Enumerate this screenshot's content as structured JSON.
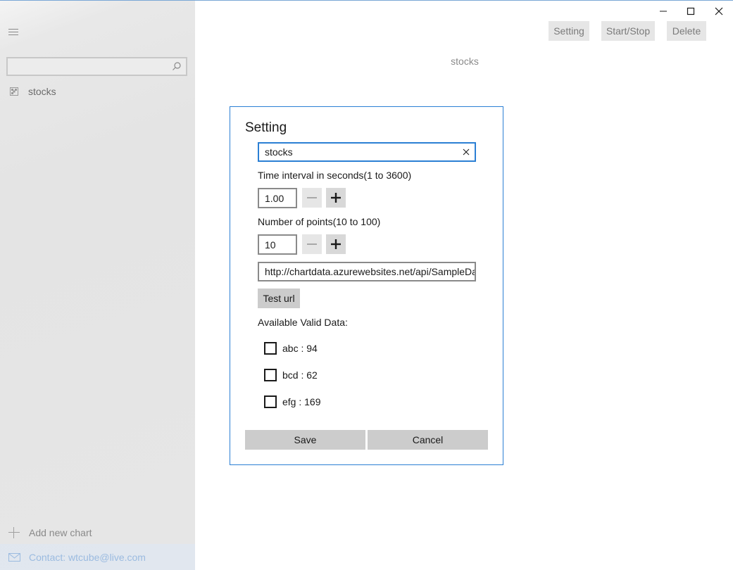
{
  "sidebar": {
    "search": {
      "value": "",
      "placeholder": ""
    },
    "charts": [
      {
        "label": "stocks"
      }
    ],
    "add_chart_label": "Add new chart",
    "contact_label": "Contact: wtcube@live.com"
  },
  "toolbar": {
    "setting_label": "Setting",
    "start_stop_label": "Start/Stop",
    "delete_label": "Delete"
  },
  "page_title": "stocks",
  "dialog": {
    "title": "Setting",
    "name_value": "stocks",
    "interval_label": "Time interval in seconds(1 to 3600)",
    "interval_value": "1.00",
    "points_label": "Number of points(10 to 100)",
    "points_value": "10",
    "url_value": "http://chartdata.azurewebsites.net/api/SampleData",
    "test_url_label": "Test url",
    "available_label": "Available Valid Data:",
    "data_items": [
      {
        "label": "abc : 94",
        "checked": false
      },
      {
        "label": "bcd : 62",
        "checked": false
      },
      {
        "label": "efg : 169",
        "checked": false
      }
    ],
    "save_label": "Save",
    "cancel_label": "Cancel"
  },
  "icons": {
    "menu": "hamburger-icon",
    "search": "search-icon",
    "chart": "chart-icon",
    "add": "plus-icon",
    "mail": "mail-icon",
    "minimize": "minimize-icon",
    "maximize": "maximize-icon",
    "close": "close-icon",
    "clear": "clear-icon",
    "decrement": "minus-icon",
    "increment": "plus-icon"
  },
  "colors": {
    "accent": "#2b7fd4",
    "sidebar_bg": "#e6e6e6",
    "button_bg": "#cccccc",
    "contact_text": "#9bbbe0"
  }
}
